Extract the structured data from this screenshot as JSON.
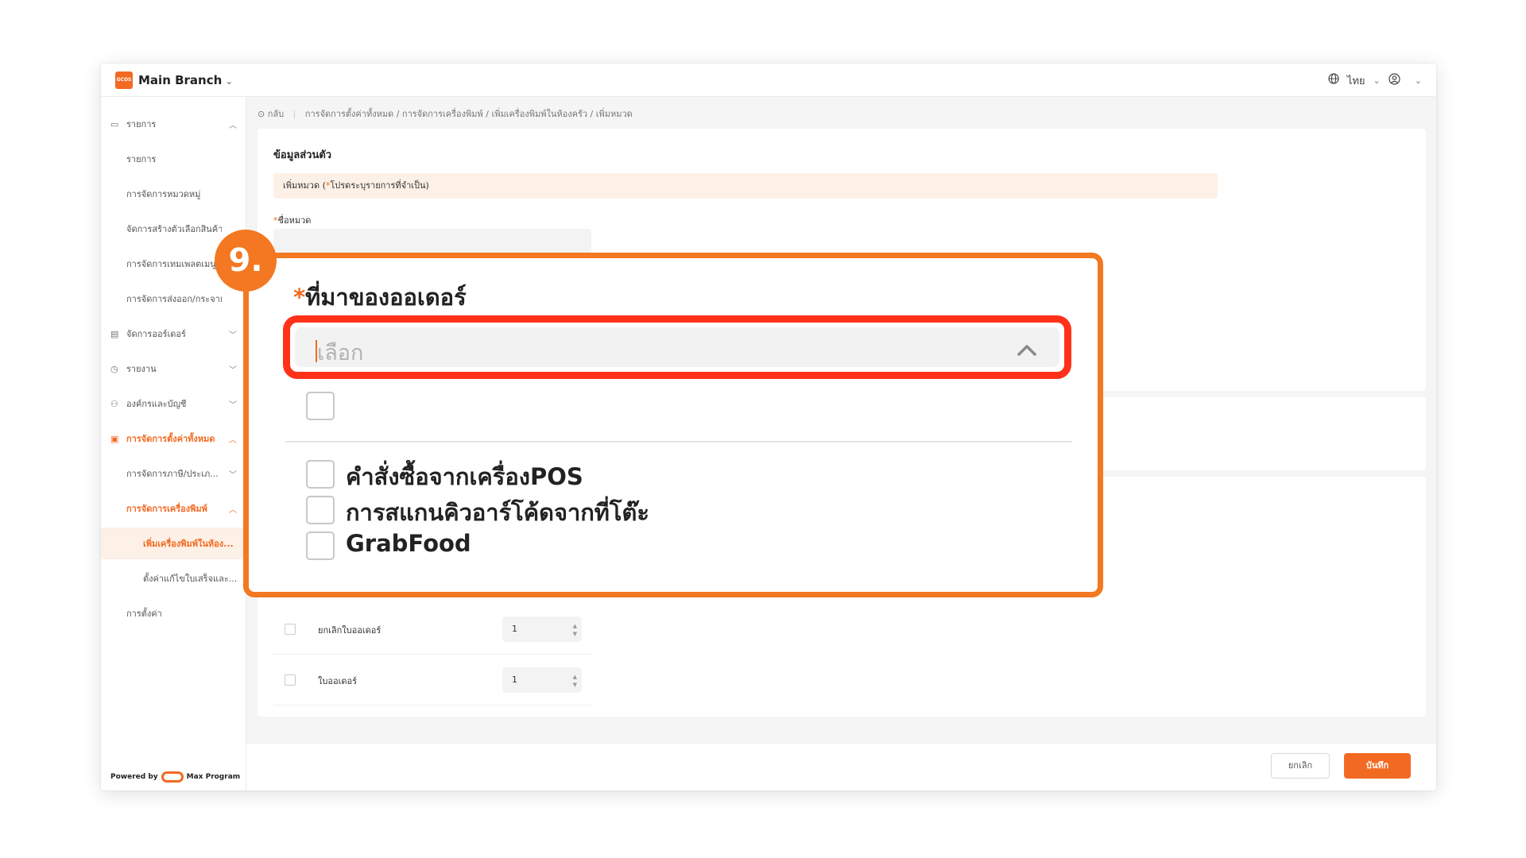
{
  "topbar": {
    "logo_text": "GCOS",
    "branch": "Main Branch",
    "language": "ไทย"
  },
  "sidebar": {
    "items": [
      {
        "label": "รายการ"
      },
      {
        "label": "รายการ"
      },
      {
        "label": "การจัดการหมวดหมู่"
      },
      {
        "label": "จัดการสร้างตัวเลือกสินค้า"
      },
      {
        "label": "การจัดการเทมเพลตเมนู"
      },
      {
        "label": "การจัดการส่งออก/กระจาย..."
      },
      {
        "label": "จัดการออร์เดอร์"
      },
      {
        "label": "รายงาน"
      },
      {
        "label": "องค์กรและบัญชี"
      },
      {
        "label": "การจัดการตั้งค่าทั้งหมด"
      },
      {
        "label": "การจัดการภาษี/ประเภ..."
      },
      {
        "label": "การจัดการเครื่องพิมพ์"
      },
      {
        "label": "เพิ่มเครื่องพิมพ์ในห้อง..."
      },
      {
        "label": "ตั้งค่าแก้ไขใบเสร็จและ..."
      },
      {
        "label": "การตั้งค่า"
      }
    ],
    "powered_by": "Powered by",
    "brand": "Max Program"
  },
  "breadcrumb": {
    "back": "กลับ",
    "path": "การจัดการตั้งค่าทั้งหมด / การจัดการเครื่องพิมพ์ / เพิ่มเครื่องพิมพ์ในห้องครัว / เพิ่มหมวด"
  },
  "form": {
    "section_title": "ข้อมูลส่วนตัว",
    "banner_prefix": "เพิ่มหมวด  (",
    "banner_star": "*",
    "banner_suffix": "โปรดระบุรายการที่จำเป็น)",
    "field_star": "*",
    "field_label": "ชื่อหมวด",
    "rows": [
      {
        "label": "ยกเลิกใบออเดอร์",
        "value": "1"
      },
      {
        "label": "ใบออเดอร์",
        "value": "1"
      }
    ]
  },
  "footer": {
    "cancel": "ยกเลิก",
    "save": "บันทึก"
  },
  "callout": {
    "step": "9.",
    "star": "*",
    "label": "ที่มาของออเดอร์",
    "placeholder": "เลือก",
    "options": [
      "",
      "คำสั่งซื้อจากเครื่องPOS",
      "การสแกนคิวอาร์โค้ดจากที่โต๊ะ",
      "GrabFood"
    ]
  },
  "colors": {
    "accent": "#f26a21",
    "callout_border": "#f37821",
    "highlight": "#ff3219"
  }
}
